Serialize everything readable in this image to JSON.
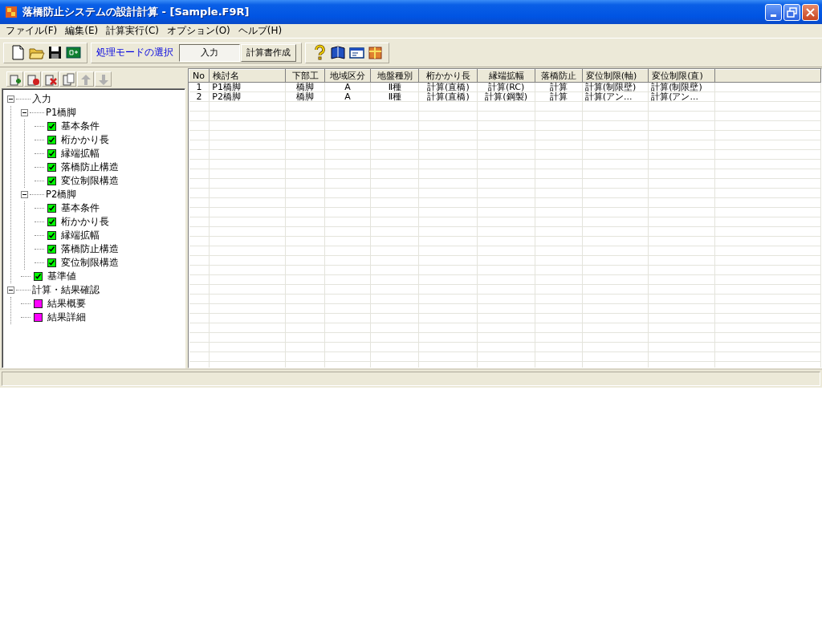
{
  "window": {
    "title": "落橋防止システムの設計計算 - [Sample.F9R]"
  },
  "menu": [
    "ファイル(F)",
    "編集(E)",
    "計算実行(C)",
    "オプション(O)",
    "ヘルプ(H)"
  ],
  "toolbar": {
    "mode_label": "処理モードの選択",
    "modes": [
      {
        "label": "入力",
        "selected": true
      },
      {
        "label": "計算書作成",
        "selected": false
      }
    ]
  },
  "tree_toolbar": [
    {
      "kind": "add",
      "disabled": false
    },
    {
      "kind": "delete",
      "disabled": false
    },
    {
      "kind": "remove",
      "disabled": false
    },
    {
      "kind": "copy",
      "disabled": false
    },
    {
      "kind": "up",
      "disabled": true
    },
    {
      "kind": "down",
      "disabled": true
    }
  ],
  "tree": [
    {
      "label": "入力",
      "expanded": true,
      "children": [
        {
          "label": "P1橋脚",
          "expanded": true,
          "children": [
            {
              "label": "基本条件",
              "checked": true,
              "color": "#00ff00"
            },
            {
              "label": "桁かかり長",
              "checked": true,
              "color": "#00ff00"
            },
            {
              "label": "縁端拡幅",
              "checked": true,
              "color": "#00ff00"
            },
            {
              "label": "落橋防止構造",
              "checked": true,
              "color": "#00ff00"
            },
            {
              "label": "変位制限構造",
              "checked": true,
              "color": "#00ff00"
            }
          ]
        },
        {
          "label": "P2橋脚",
          "expanded": true,
          "children": [
            {
              "label": "基本条件",
              "checked": true,
              "color": "#00ff00"
            },
            {
              "label": "桁かかり長",
              "checked": true,
              "color": "#00ff00"
            },
            {
              "label": "縁端拡幅",
              "checked": true,
              "color": "#00ff00"
            },
            {
              "label": "落橋防止構造",
              "checked": true,
              "color": "#00ff00"
            },
            {
              "label": "変位制限構造",
              "checked": true,
              "color": "#00ff00"
            }
          ]
        },
        {
          "label": "基準値",
          "checked": true,
          "color": "#00ff00"
        }
      ]
    },
    {
      "label": "計算・結果確認",
      "expanded": true,
      "children": [
        {
          "label": "結果概要",
          "checked": false,
          "color": "#ff00ff"
        },
        {
          "label": "結果詳細",
          "checked": false,
          "color": "#ff00ff"
        }
      ]
    }
  ],
  "table": {
    "columns": [
      "No",
      "検討名",
      "下部工",
      "地域区分",
      "地盤種別",
      "桁かかり長",
      "縁端拡幅",
      "落橋防止",
      "変位制限(軸)",
      "変位制限(直)"
    ],
    "rows": [
      [
        "1",
        "P1橋脚",
        "橋脚",
        "A",
        "Ⅱ種",
        "計算(直橋)",
        "計算(RC)",
        "計算",
        "計算(制限壁)",
        "計算(制限壁)"
      ],
      [
        "2",
        "P2橋脚",
        "橋脚",
        "A",
        "Ⅱ種",
        "計算(直橋)",
        "計算(鋼製)",
        "計算",
        "計算(アン...",
        "計算(アン..."
      ]
    ]
  }
}
